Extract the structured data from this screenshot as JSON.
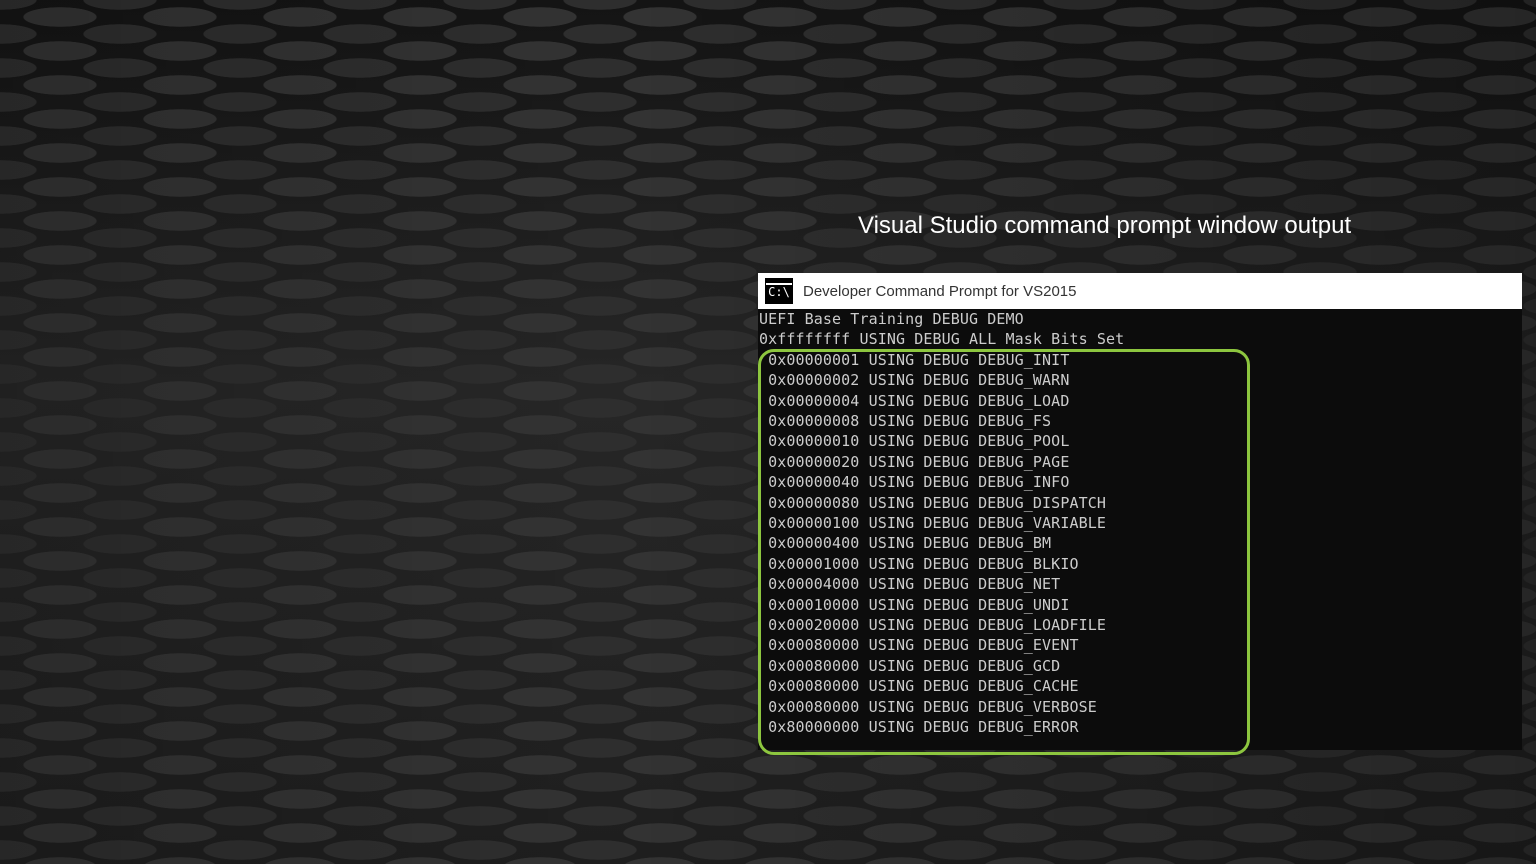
{
  "slide": {
    "caption": "Visual Studio command prompt window output"
  },
  "window": {
    "icon_name": "console-icon",
    "icon_glyph": "C:\\",
    "title": "Developer Command Prompt for VS2015"
  },
  "console": {
    "lines": [
      "UEFI Base Training DEBUG DEMO",
      "0xffffffff USING DEBUG ALL Mask Bits Set",
      " 0x00000001 USING DEBUG DEBUG_INIT",
      " 0x00000002 USING DEBUG DEBUG_WARN",
      " 0x00000004 USING DEBUG DEBUG_LOAD",
      " 0x00000008 USING DEBUG DEBUG_FS",
      " 0x00000010 USING DEBUG DEBUG_POOL",
      " 0x00000020 USING DEBUG DEBUG_PAGE",
      " 0x00000040 USING DEBUG DEBUG_INFO",
      " 0x00000080 USING DEBUG DEBUG_DISPATCH",
      " 0x00000100 USING DEBUG DEBUG_VARIABLE",
      " 0x00000400 USING DEBUG DEBUG_BM",
      " 0x00001000 USING DEBUG DEBUG_BLKIO",
      " 0x00004000 USING DEBUG DEBUG_NET",
      " 0x00010000 USING DEBUG DEBUG_UNDI",
      " 0x00020000 USING DEBUG DEBUG_LOADFILE",
      " 0x00080000 USING DEBUG DEBUG_EVENT",
      " 0x00080000 USING DEBUG DEBUG_GCD",
      " 0x00080000 USING DEBUG DEBUG_CACHE",
      " 0x00080000 USING DEBUG DEBUG_VERBOSE",
      " 0x80000000 USING DEBUG DEBUG_ERROR"
    ]
  },
  "colors": {
    "highlight": "#8dc63f",
    "console_bg": "#0c0c0c",
    "console_text": "#cccccc"
  }
}
